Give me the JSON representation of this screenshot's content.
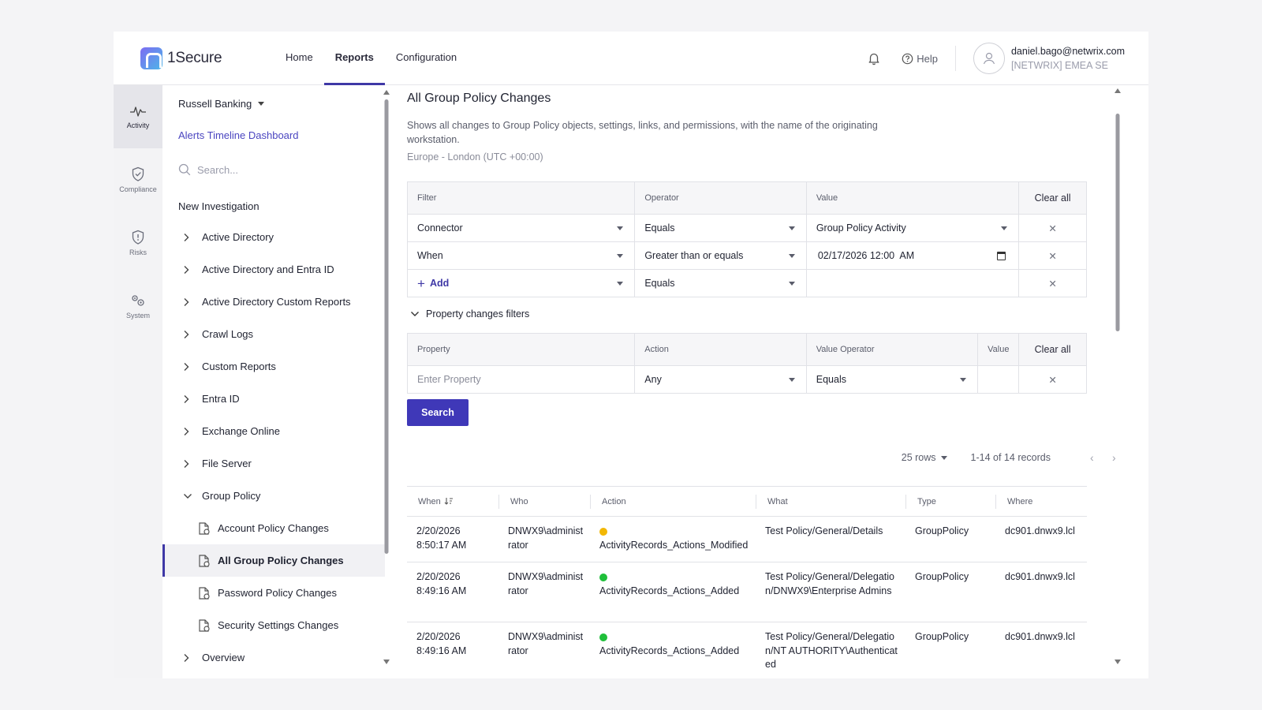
{
  "app": {
    "name": "1Secure"
  },
  "topnav": {
    "items": [
      "Home",
      "Reports",
      "Configuration"
    ],
    "active": "Reports"
  },
  "header": {
    "help_label": "Help",
    "user_email": "daniel.bago@netwrix.com",
    "user_org": "[NETWRIX] EMEA SE"
  },
  "rail": {
    "items": [
      "Activity",
      "Compliance",
      "Risks",
      "System"
    ],
    "active": "Activity"
  },
  "sidebar": {
    "tenant": "Russell Banking",
    "dashboard_link": "Alerts Timeline Dashboard",
    "search_placeholder": "Search...",
    "heading": "New Investigation",
    "items": [
      {
        "label": "Active Directory",
        "expanded": false
      },
      {
        "label": "Active Directory and Entra ID",
        "expanded": false
      },
      {
        "label": "Active Directory Custom Reports",
        "expanded": false
      },
      {
        "label": "Crawl Logs",
        "expanded": false
      },
      {
        "label": "Custom Reports",
        "expanded": false
      },
      {
        "label": "Entra ID",
        "expanded": false
      },
      {
        "label": "Exchange Online",
        "expanded": false
      },
      {
        "label": "File Server",
        "expanded": false
      },
      {
        "label": "Group Policy",
        "expanded": true
      },
      {
        "label": "Overview",
        "expanded": false
      }
    ],
    "group_policy_children": [
      "Account Policy Changes",
      "All Group Policy Changes",
      "Password Policy Changes",
      "Security Settings Changes"
    ],
    "selected": "All Group Policy Changes"
  },
  "main": {
    "title": "All Group Policy Changes",
    "description": "Shows all changes to Group Policy objects, settings, links, and permissions, with the name of the originating workstation.",
    "timezone": "Europe - London (UTC +00:00)"
  },
  "filters": {
    "headers": {
      "filter": "Filter",
      "operator": "Operator",
      "value": "Value",
      "clear": "Clear all"
    },
    "rows": [
      {
        "filter": "Connector",
        "operator": "Equals",
        "value": "Group Policy Activity"
      },
      {
        "filter": "When",
        "operator": "Greater than or equals",
        "value": "02/17/2026 12:00  AM"
      }
    ],
    "add_label": "Add",
    "add_operator": "Equals"
  },
  "property_filters": {
    "toggle_label": "Property changes filters",
    "headers": {
      "property": "Property",
      "action": "Action",
      "value_operator": "Value Operator",
      "value": "Value",
      "clear": "Clear all"
    },
    "row": {
      "property_placeholder": "Enter Property",
      "action": "Any",
      "value_operator": "Equals"
    }
  },
  "search_label": "Search",
  "pager": {
    "rows": "25 rows",
    "range": "1-14 of 14 records"
  },
  "results": {
    "columns": [
      "When",
      "Who",
      "Action",
      "What",
      "Type",
      "Where"
    ],
    "rows": [
      {
        "when_date": "2/20/2026",
        "when_time": "8:50:17 AM",
        "who": "DNWX9\\administrator",
        "action": "ActivityRecords_Actions_Modified",
        "what": "Test Policy/General/Details",
        "type": "GroupPolicy",
        "where": "dc901.dnwx9.lcl",
        "status_color": "#f2b705"
      },
      {
        "when_date": "2/20/2026",
        "when_time": "8:49:16 AM",
        "who": "DNWX9\\administrator",
        "action": "ActivityRecords_Actions_Added",
        "what": "Test Policy/General/Delegation/DNWX9\\Enterprise Admins",
        "type": "GroupPolicy",
        "where": "dc901.dnwx9.lcl",
        "status_color": "#1fbf3a"
      },
      {
        "when_date": "2/20/2026",
        "when_time": "8:49:16 AM",
        "who": "DNWX9\\administrator",
        "action": "ActivityRecords_Actions_Added",
        "what": "Test Policy/General/Delegation/NT AUTHORITY\\Authenticated",
        "type": "GroupPolicy",
        "where": "dc901.dnwx9.lcl",
        "status_color": "#1fbf3a"
      }
    ]
  }
}
